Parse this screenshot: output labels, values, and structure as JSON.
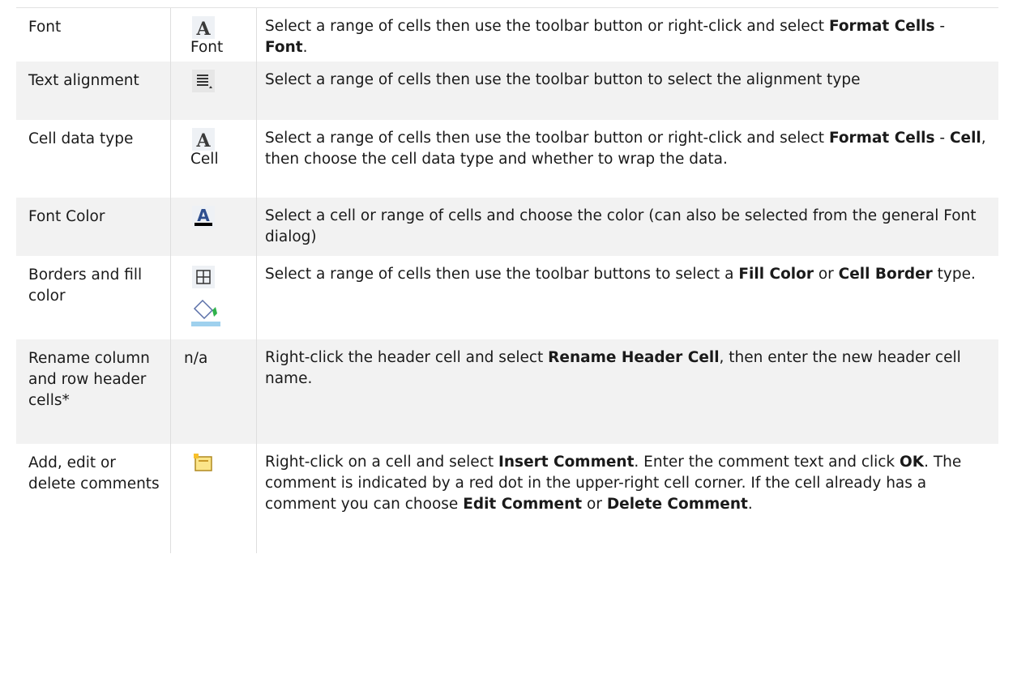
{
  "rows": [
    {
      "feature": "Font",
      "icon": "font-a-icon",
      "icon_label": "Font",
      "desc": [
        "Select a range of cells then use the toolbar button or right-click and select ",
        {
          "b": "Format Cells"
        },
        " - ",
        {
          "b": "Font"
        },
        "."
      ]
    },
    {
      "feature": "Text alignment",
      "icon": "text-align-icon",
      "desc": [
        "Select a range of cells then use the toolbar button to select the alignment type"
      ]
    },
    {
      "feature": "Cell data type",
      "icon": "cell-a-icon",
      "icon_label": "Cell",
      "desc": [
        "Select a range of cells then use the toolbar button or right-click and select ",
        {
          "b": "Format Cells"
        },
        " - ",
        {
          "b": "Cell"
        },
        ", then choose the cell data type and whether to wrap the data."
      ]
    },
    {
      "feature": "Font Color",
      "icon": "font-color-icon",
      "desc": [
        "Select a cell or range of cells and choose the color (can also be selected from the general Font dialog)"
      ]
    },
    {
      "feature": "Borders and fill color",
      "icon": "borders-icon",
      "icon2": "fill-bucket-icon",
      "desc": [
        "Select a range of cells then use the toolbar buttons to select a ",
        {
          "b": "Fill Color"
        },
        " or ",
        {
          "b": "Cell Border"
        },
        " type."
      ]
    },
    {
      "feature": "Rename column and row header cells*",
      "icon_text": "n/a",
      "desc": [
        "Right-click the header cell and select ",
        {
          "b": "Rename Header Cell"
        },
        ", then enter the new header cell name."
      ]
    },
    {
      "feature": "Add, edit or delete comments",
      "icon": "comment-icon",
      "desc": [
        "Right-click on a cell and select ",
        {
          "b": "Insert Comment"
        },
        ". Enter the comment text and click ",
        {
          "b": "OK"
        },
        ". The comment is indicated by a red dot in the upper-right cell corner. If the cell already has a comment you can choose ",
        {
          "b": "Edit Comment"
        },
        " or ",
        {
          "b": "Delete Comment"
        },
        "."
      ]
    }
  ],
  "colors": {
    "alt_row": "#f2f2f2",
    "text": "#1a1a1a",
    "font_color_bar": "#000000",
    "icon_blue": "#2f4f8f"
  }
}
